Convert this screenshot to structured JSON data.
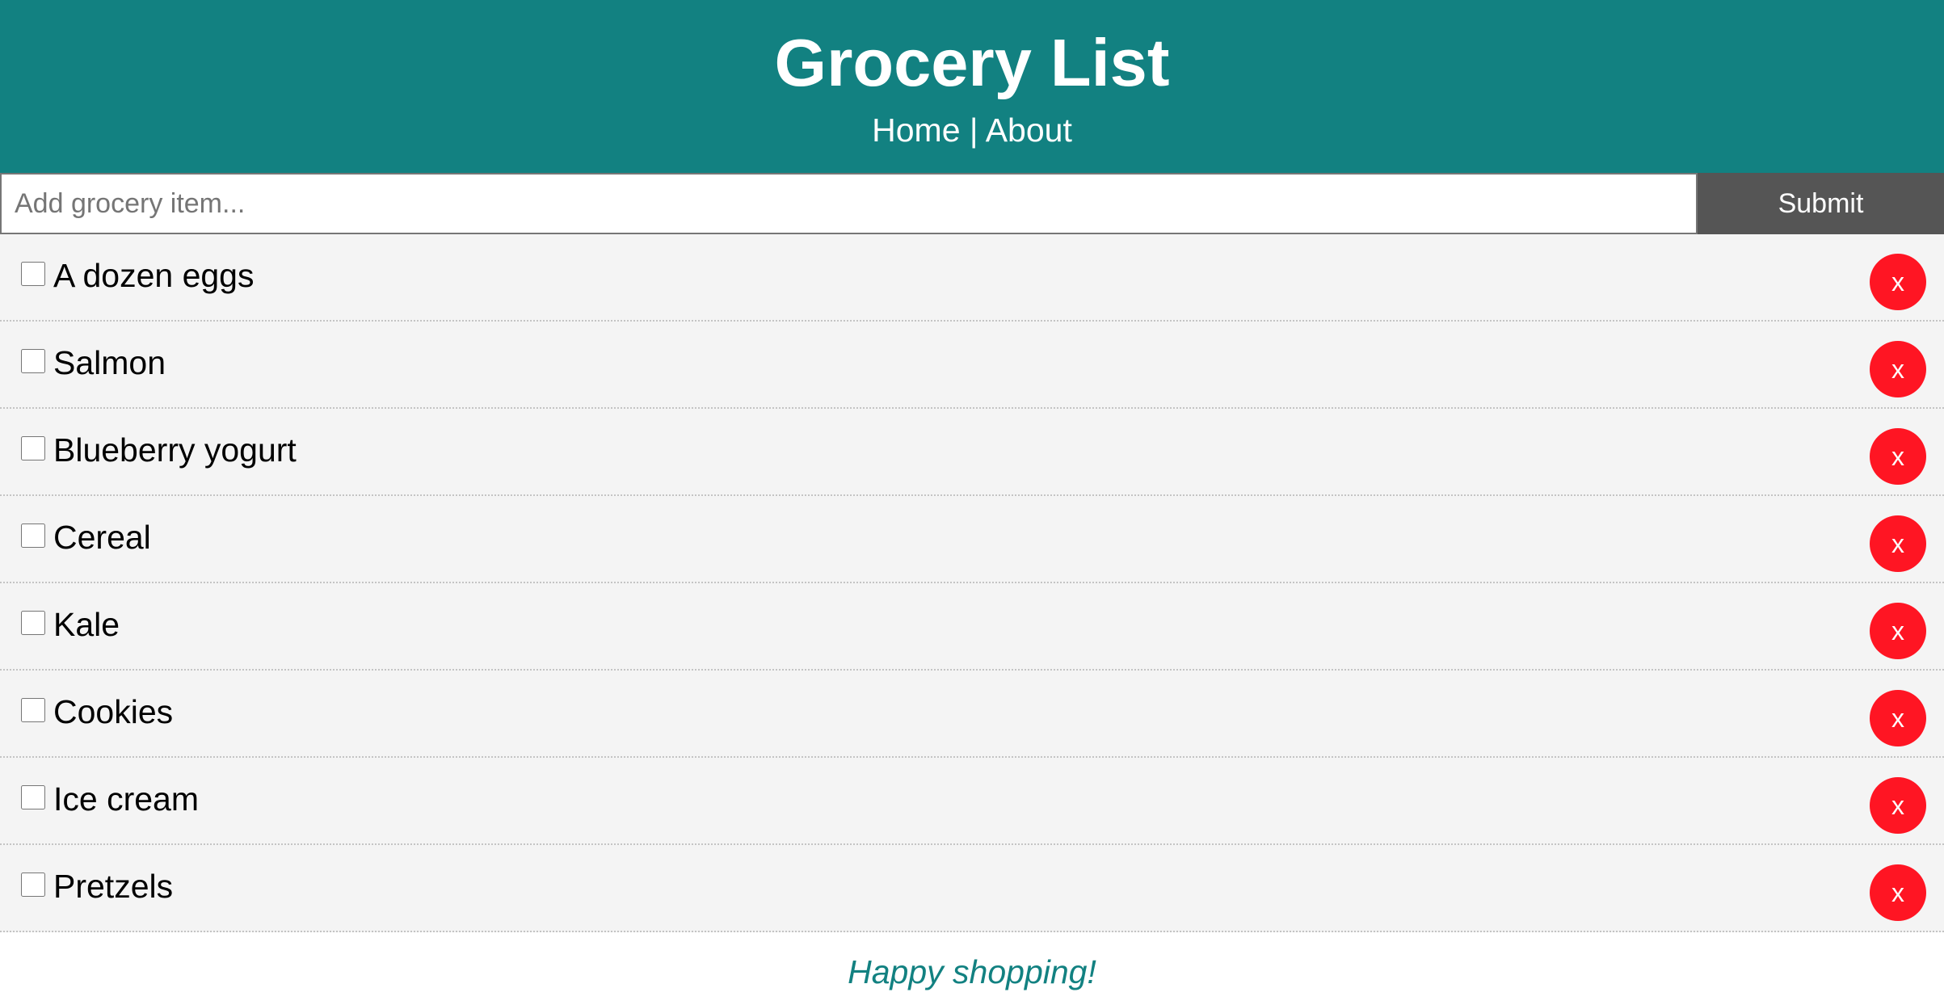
{
  "colors": {
    "header_bg": "#128181",
    "submit_bg": "#555555",
    "delete_bg": "#ff1523",
    "row_bg": "#f4f4f4",
    "footer_text": "#128181"
  },
  "header": {
    "title": "Grocery List",
    "nav": {
      "home": "Home",
      "separator": " | ",
      "about": "About"
    }
  },
  "form": {
    "input_value": "",
    "placeholder": "Add grocery item...",
    "submit_label": "Submit"
  },
  "items": [
    {
      "label": "A dozen eggs",
      "checked": false,
      "delete_label": "x"
    },
    {
      "label": "Salmon",
      "checked": false,
      "delete_label": "x"
    },
    {
      "label": "Blueberry yogurt",
      "checked": false,
      "delete_label": "x"
    },
    {
      "label": "Cereal",
      "checked": false,
      "delete_label": "x"
    },
    {
      "label": "Kale",
      "checked": false,
      "delete_label": "x"
    },
    {
      "label": "Cookies",
      "checked": false,
      "delete_label": "x"
    },
    {
      "label": "Ice cream",
      "checked": false,
      "delete_label": "x"
    },
    {
      "label": "Pretzels",
      "checked": false,
      "delete_label": "x"
    }
  ],
  "footer": {
    "text": "Happy shopping!"
  }
}
